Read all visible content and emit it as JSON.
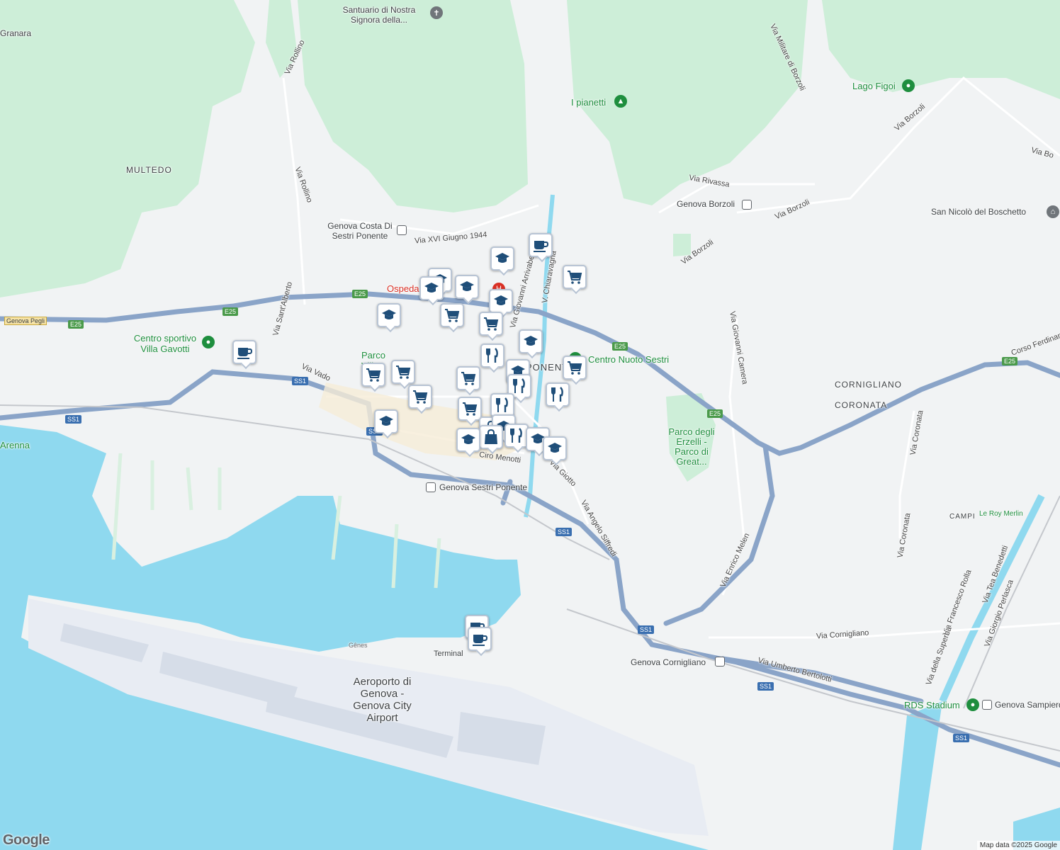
{
  "map": {
    "area_labels": [
      "MULTEDO",
      "CORNIGLIANO",
      "CORONATA",
      "CAMPI"
    ],
    "districts": {
      "ponente_fragment": "PONENTE"
    },
    "road_labels": [
      "Via Rollino",
      "Via Rollino",
      "Via Sant'Alberto",
      "Via Vado",
      "Via XVI Giugno 1944",
      "Via Giovanni Arrivabene",
      "V. Chiaravagna",
      "Via Rivassa",
      "Via Borzoli",
      "Via Borzoli",
      "Via Borzoli",
      "Via Militare di Borzoli",
      "Via Giovanni Camera",
      "Via Enrico Melen",
      "Via Angelo Siffredi",
      "Via Giotto",
      "Via Cornigliano",
      "Via Umberto Bertolotti",
      "Via Coronata",
      "Via Coronata",
      "Via Francesco Rolla",
      "Via Tea Benedetti",
      "Via Giorgio Perlasca",
      "Via della Superba",
      "Corso Ferdinando",
      "Via Bo",
      "Ciro Menotti"
    ],
    "places": {
      "santuario": "Santuario di Nostra Signora della...",
      "costa": "Genova Costa Di Sestri Ponente",
      "ospedale": "Ospedale",
      "centro_sportivo": "Centro sportivo Villa Gavotti",
      "parco_villa": "Parco Villa Rossi",
      "centro_nuoto": "Centro Nuoto Sestri",
      "pianetti": "I pianetti",
      "lago": "Lago Figoi",
      "borzoli_station": "Genova Borzoli",
      "san_nicolo": "San Nicolò del Boschetto",
      "parco_erzelli": "Parco degli Erzelli - Parco di Great...",
      "sestri_station": "Genova Sestri Ponente",
      "cornigliano_station": "Genova Cornigliano",
      "rds": "RDS Stadium",
      "sampierdarena": "Genova Sampierdarena",
      "le_roy": "Le Roy Merlin",
      "terminal": "Terminal",
      "genes": "Gênes",
      "airport": "Aeroporto di Genova - Genova City Airport",
      "pegli": "Genova Pegli",
      "granara": "Granara",
      "arenna": "Arenna"
    },
    "shields": [
      "E25",
      "E25",
      "E25",
      "E25",
      "E25",
      "E25",
      "SS1",
      "SS1",
      "SS1",
      "SS1",
      "SS1",
      "SS1",
      "SS1"
    ],
    "markers": [
      {
        "icon": "cafe-icon"
      },
      {
        "icon": "school-icon"
      },
      {
        "icon": "school-icon"
      },
      {
        "icon": "school-icon"
      },
      {
        "icon": "school-icon"
      },
      {
        "icon": "school-icon"
      },
      {
        "icon": "shopping-cart-icon"
      },
      {
        "icon": "shopping-cart-icon"
      },
      {
        "icon": "school-icon"
      },
      {
        "icon": "cafe-icon"
      },
      {
        "icon": "shopping-cart-icon"
      },
      {
        "icon": "shopping-cart-icon"
      },
      {
        "icon": "shopping-cart-icon"
      },
      {
        "icon": "school-icon"
      },
      {
        "icon": "restaurant-icon"
      },
      {
        "icon": "school-icon"
      },
      {
        "icon": "shopping-cart-icon"
      },
      {
        "icon": "shopping-cart-icon"
      },
      {
        "icon": "restaurant-icon"
      },
      {
        "icon": "restaurant-icon"
      },
      {
        "icon": "shopping-cart-icon"
      },
      {
        "icon": "restaurant-icon"
      },
      {
        "icon": "shopping-cart-icon"
      },
      {
        "icon": "shopping-bag-icon"
      },
      {
        "icon": "school-icon"
      },
      {
        "icon": "school-icon"
      },
      {
        "icon": "restaurant-icon"
      },
      {
        "icon": "school-icon"
      },
      {
        "icon": "school-icon"
      },
      {
        "icon": "shopping-bag-icon"
      },
      {
        "icon": "school-icon"
      },
      {
        "icon": "cafe-icon"
      },
      {
        "icon": "cafe-icon"
      }
    ],
    "colors": {
      "water": "#8fd9ef",
      "land": "#f1f3f4",
      "green": "#cdeed8",
      "highway": "#8aa4c8",
      "marker_icon": "#1f4e79"
    }
  },
  "attribution": "Map data ©2025 Google",
  "logo": "Google"
}
